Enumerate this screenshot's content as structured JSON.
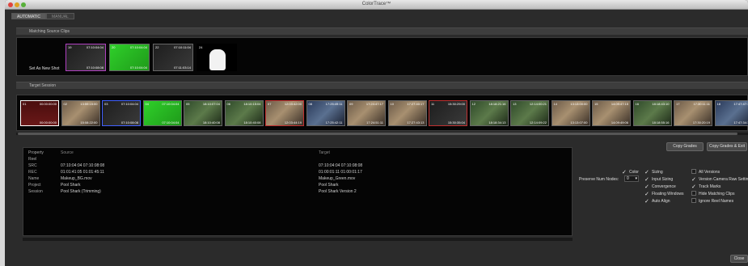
{
  "window": {
    "title": "ColorTrace™"
  },
  "tabs": [
    {
      "label": "AUTOMATIC",
      "active": true
    },
    {
      "label": "MANUAL",
      "active": false
    }
  ],
  "matching": {
    "header": "Matching Source Clips",
    "set_new_label": "Set As New Shot",
    "clips": [
      {
        "num": "19",
        "tc1": "07:10:04:04",
        "tc2": "07:10:08:08",
        "style": "dark",
        "border": "#b040c0"
      },
      {
        "num": "20",
        "tc1": "07:10:04:04",
        "tc2": "07:10:04:04",
        "style": "green",
        "border": "#666666"
      },
      {
        "num": "22",
        "tc1": "07:10:11:04",
        "tc2": "07:11:03:14",
        "style": "dark",
        "border": "#666666"
      },
      {
        "num": "24",
        "tc1": "",
        "tc2": "",
        "style": "white",
        "border": "#000000"
      }
    ]
  },
  "target": {
    "header": "Target Session",
    "clips": [
      {
        "num": "01",
        "tc1": "00:00:00:00",
        "tc2": "00:00:00:00",
        "style": "red",
        "border": "#ffffff"
      },
      {
        "num": "02",
        "tc1": "13:59:15:00",
        "tc2": "15:08:22:00",
        "style": "office",
        "border": "#666666"
      },
      {
        "num": "03",
        "tc1": "07:10:04:04",
        "tc2": "07:10:08:08",
        "style": "dark",
        "border": "#4060ff"
      },
      {
        "num": "04",
        "tc1": "07:10:04:04",
        "tc2": "07:10:04:04",
        "style": "green",
        "border": "#666666"
      },
      {
        "num": "05",
        "tc1": "18:10:07:04",
        "tc2": "18:10:40:08",
        "style": "pool",
        "border": "#666666"
      },
      {
        "num": "06",
        "tc1": "18:10:15:04",
        "tc2": "18:10:40:08",
        "style": "pool",
        "border": "#666666"
      },
      {
        "num": "07",
        "tc1": "12:03:42:00",
        "tc2": "12:03:44:19",
        "style": "office",
        "border": "#c03030"
      },
      {
        "num": "08",
        "tc1": "17:25:49:11",
        "tc2": "17:25:42:11",
        "style": "blue",
        "border": "#666666"
      },
      {
        "num": "09",
        "tc1": "17:24:47:17",
        "tc2": "17:24:51:11",
        "style": "office",
        "border": "#666666"
      },
      {
        "num": "10",
        "tc1": "17:27:40:17",
        "tc2": "17:27:43:13",
        "style": "office",
        "border": "#666666"
      },
      {
        "num": "11",
        "tc1": "15:30:29:00",
        "tc2": "15:30:35:04",
        "style": "dark",
        "border": "#c03030"
      },
      {
        "num": "12",
        "tc1": "18:18:21:16",
        "tc2": "18:18:34:13",
        "style": "pool",
        "border": "#666666"
      },
      {
        "num": "13",
        "tc1": "12:14:00:21",
        "tc2": "12:14:09:22",
        "style": "pool",
        "border": "#666666"
      },
      {
        "num": "14",
        "tc1": "13:13:00:00",
        "tc2": "13:13:07:00",
        "style": "office",
        "border": "#666666"
      },
      {
        "num": "15",
        "tc1": "14:09:47:15",
        "tc2": "14:09:49:06",
        "style": "office",
        "border": "#666666"
      },
      {
        "num": "16",
        "tc1": "18:18:43:10",
        "tc2": "18:18:55:16",
        "style": "pool",
        "border": "#666666"
      },
      {
        "num": "17",
        "tc1": "17:30:11:11",
        "tc2": "17:30:20:19",
        "style": "office",
        "border": "#666666"
      },
      {
        "num": "18",
        "tc1": "17:47:47:17",
        "tc2": "17:47:34:17",
        "style": "blue",
        "border": "#666666"
      }
    ]
  },
  "info": {
    "headers": [
      "Property",
      "Source",
      "Target"
    ],
    "rows": [
      {
        "prop": "Reel",
        "source": "",
        "target": ""
      },
      {
        "prop": "SRC",
        "source": "07:10:04:04  07:10:08:08",
        "target": "07:10:04:04  07:10:08:08"
      },
      {
        "prop": "REC",
        "source": "01:01:41:05  01:01:45:11",
        "target": "01:00:01:11  01:00:01:17"
      },
      {
        "prop": "Name",
        "source": "Makeup_BG.mov",
        "target": "Makeup_Green.mov"
      },
      {
        "prop": "Project",
        "source": "Pool Shark",
        "target": "Pool Shark"
      },
      {
        "prop": "Session",
        "source": "Pool Shark (Trimming)",
        "target": "Pool Shark Version 2"
      }
    ]
  },
  "buttons": {
    "copy_grades": "Copy Grades",
    "copy_grades_exit": "Copy Grades & Exit",
    "close": "Close"
  },
  "options": {
    "preserve_label": "Preserve Num Nodes:",
    "preserve_value": "0",
    "checks": [
      {
        "label": "Color",
        "checked": true
      },
      {
        "label": "Sizing",
        "checked": true
      },
      {
        "label": "All Versions",
        "checked": false
      },
      {
        "label": "Input Sizing",
        "checked": true
      },
      {
        "label": "Version Camera Raw Settings",
        "checked": true
      },
      {
        "label": "Convergence",
        "checked": true
      },
      {
        "label": "Track Marks",
        "checked": true
      },
      {
        "label": "Floating Windows",
        "checked": true
      },
      {
        "label": "Hide Matching Clips",
        "checked": false
      },
      {
        "label": "Auto Align",
        "checked": true
      },
      {
        "label": "Ignore Reel Names",
        "checked": false
      }
    ]
  },
  "colors": {
    "green_screen": "#2fd02a",
    "highlight_purple": "#b040c0",
    "highlight_blue": "#4060ff",
    "highlight_red": "#c03030"
  }
}
